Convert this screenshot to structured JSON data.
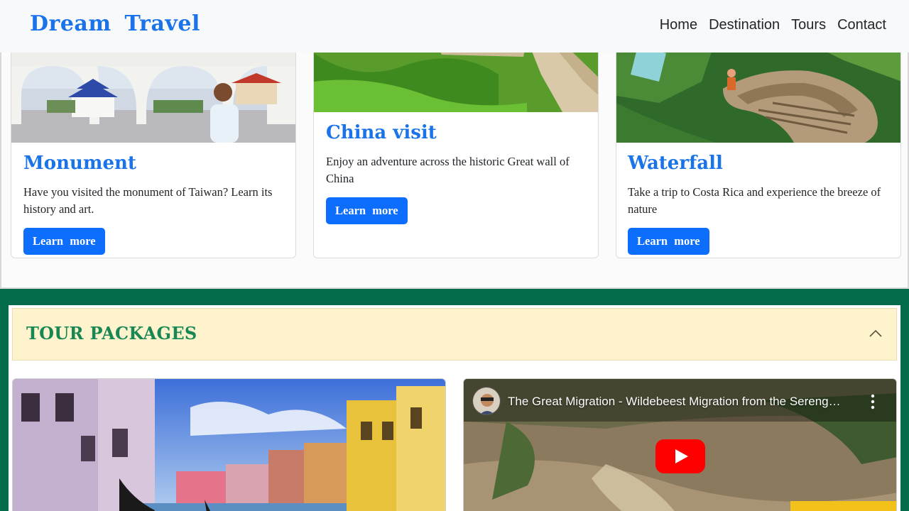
{
  "nav": {
    "brand": "Dream Travel",
    "links": [
      "Home",
      "Destination",
      "Tours",
      "Contact"
    ]
  },
  "destinations": [
    {
      "title": "Monument",
      "text": "Have you visited the monument of Taiwan? Learn its history and art.",
      "button": "Learn more"
    },
    {
      "title": "China visit",
      "text": "Enjoy an adventure across the historic Great wall of China",
      "button": "Learn more"
    },
    {
      "title": "Waterfall",
      "text": "Take a trip to Costa Rica and experience the breeze of nature",
      "button": "Learn more"
    }
  ],
  "tours": {
    "heading": "TOUR PACKAGES",
    "video": {
      "title": "The Great Migration - Wildebeest Migration from the Sereng…"
    }
  },
  "colors": {
    "brand": "#1a73e8",
    "primary_button": "#0d6efd",
    "tour_section_bg": "#036c4a",
    "accordion_bg": "#fff3cd",
    "accordion_title": "#198754"
  }
}
